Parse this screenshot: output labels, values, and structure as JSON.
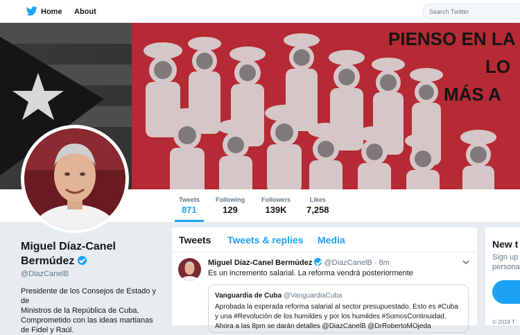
{
  "topbar": {
    "home_label": "Home",
    "about_label": "About",
    "search_placeholder": "Search Twitter"
  },
  "banner": {
    "headline_line1": "PIENSO EN LA",
    "headline_line2": "LO",
    "headline_line3": "MÁS A"
  },
  "stats": [
    {
      "label": "Tweets",
      "value": "871"
    },
    {
      "label": "Following",
      "value": "129"
    },
    {
      "label": "Followers",
      "value": "139K"
    },
    {
      "label": "Likes",
      "value": "7,258"
    }
  ],
  "profile": {
    "name_line1": "Miguel Díaz-Canel",
    "name_line2": "Bermúdez",
    "handle": "@DiazCanelB",
    "bio_lines": [
      "Presidente de los Consejos de Estado y de",
      "Ministros de la República de Cuba.",
      "Comprometido con las ideas martianas",
      "de Fidel y Raúl."
    ]
  },
  "timeline": {
    "tabs": [
      "Tweets",
      "Tweets & replies",
      "Media"
    ],
    "tweet": {
      "name": "Miguel Díaz-Canel Bermúdez",
      "handle": "@DiazCanelB",
      "time": "8m",
      "text": "Es un incremento salarial. La reforma vendrá posteriormente",
      "quote": {
        "name": "Vanguardia de Cuba",
        "handle": "@VanguardiaCuba",
        "lines": [
          "Aprobada la esperada reforma salarial al sector presupuestado. Esto es #Cuba",
          "y una #Revolución de los humildes y por los humildes #SomosContinuidad.",
          "Ahora a las 8pm se darán detalles @DiazCanelB @DrRobertoMOjeda"
        ]
      }
    }
  },
  "sidebar": {
    "title": "New t",
    "sub_line1": "Sign up",
    "sub_line2": "personal",
    "copyright": "© 2019 T"
  },
  "colors": {
    "accent": "#1da1f2",
    "text": "#14171a",
    "muted": "#657786",
    "page_bg": "#e6ecf0",
    "banner_red": "#c0303a"
  }
}
